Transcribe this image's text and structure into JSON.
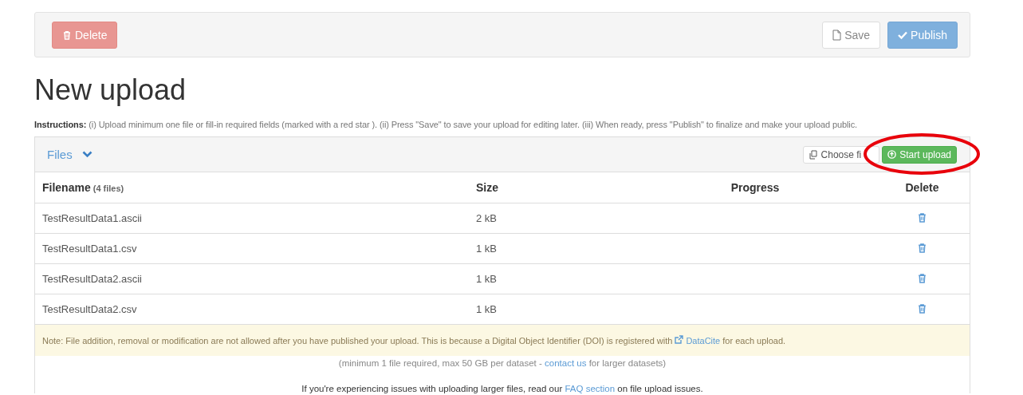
{
  "toolbar": {
    "delete_button": "Delete",
    "save_button": "Save",
    "publish_button": "Publish"
  },
  "title": "New upload",
  "instructions": "**Instructions:** (i) Upload minimum one file or fill-in required fields (marked with a red star ). (ii) Press \"Save\" to save your upload for editing later. (iii) When ready, press \"Publish\" to finalize and make your upload public.",
  "files_panel": {
    "heading": "Files",
    "expanded": true,
    "choose_button": "Choose fi",
    "start_button": "Start upload",
    "annotation": {
      "kind": "ellipse",
      "color": "#e8000b"
    },
    "columns": [
      {
        "label": "Filename",
        "note": "(4 files)"
      },
      {
        "label": "Size"
      },
      {
        "label": "Progress"
      },
      {
        "label": "Delete"
      }
    ],
    "rows": [
      {
        "filename": "TestResultData1.ascii",
        "size": "2 kB"
      },
      {
        "filename": "TestResultData1.csv",
        "size": "1 kB"
      },
      {
        "filename": "TestResultData2.ascii",
        "size": "1 kB"
      },
      {
        "filename": "TestResultData2.csv",
        "size": "1 kB"
      }
    ],
    "note": {
      "before": "Note: File addition, removal or modification are not allowed after you have published your upload. This is because a Digital Object Identifier (DOI) is registered with ",
      "link": "DataCite",
      "after": " for each upload."
    },
    "limits": {
      "before": "(minimum 1 file required, max 50 GB per dataset - ",
      "link": "contact us",
      "after": " for larger datasets)"
    },
    "help": {
      "before": "If you're experiencing issues with uploading larger files, read our ",
      "link": "FAQ section",
      "after": " on file upload issues."
    }
  }
}
